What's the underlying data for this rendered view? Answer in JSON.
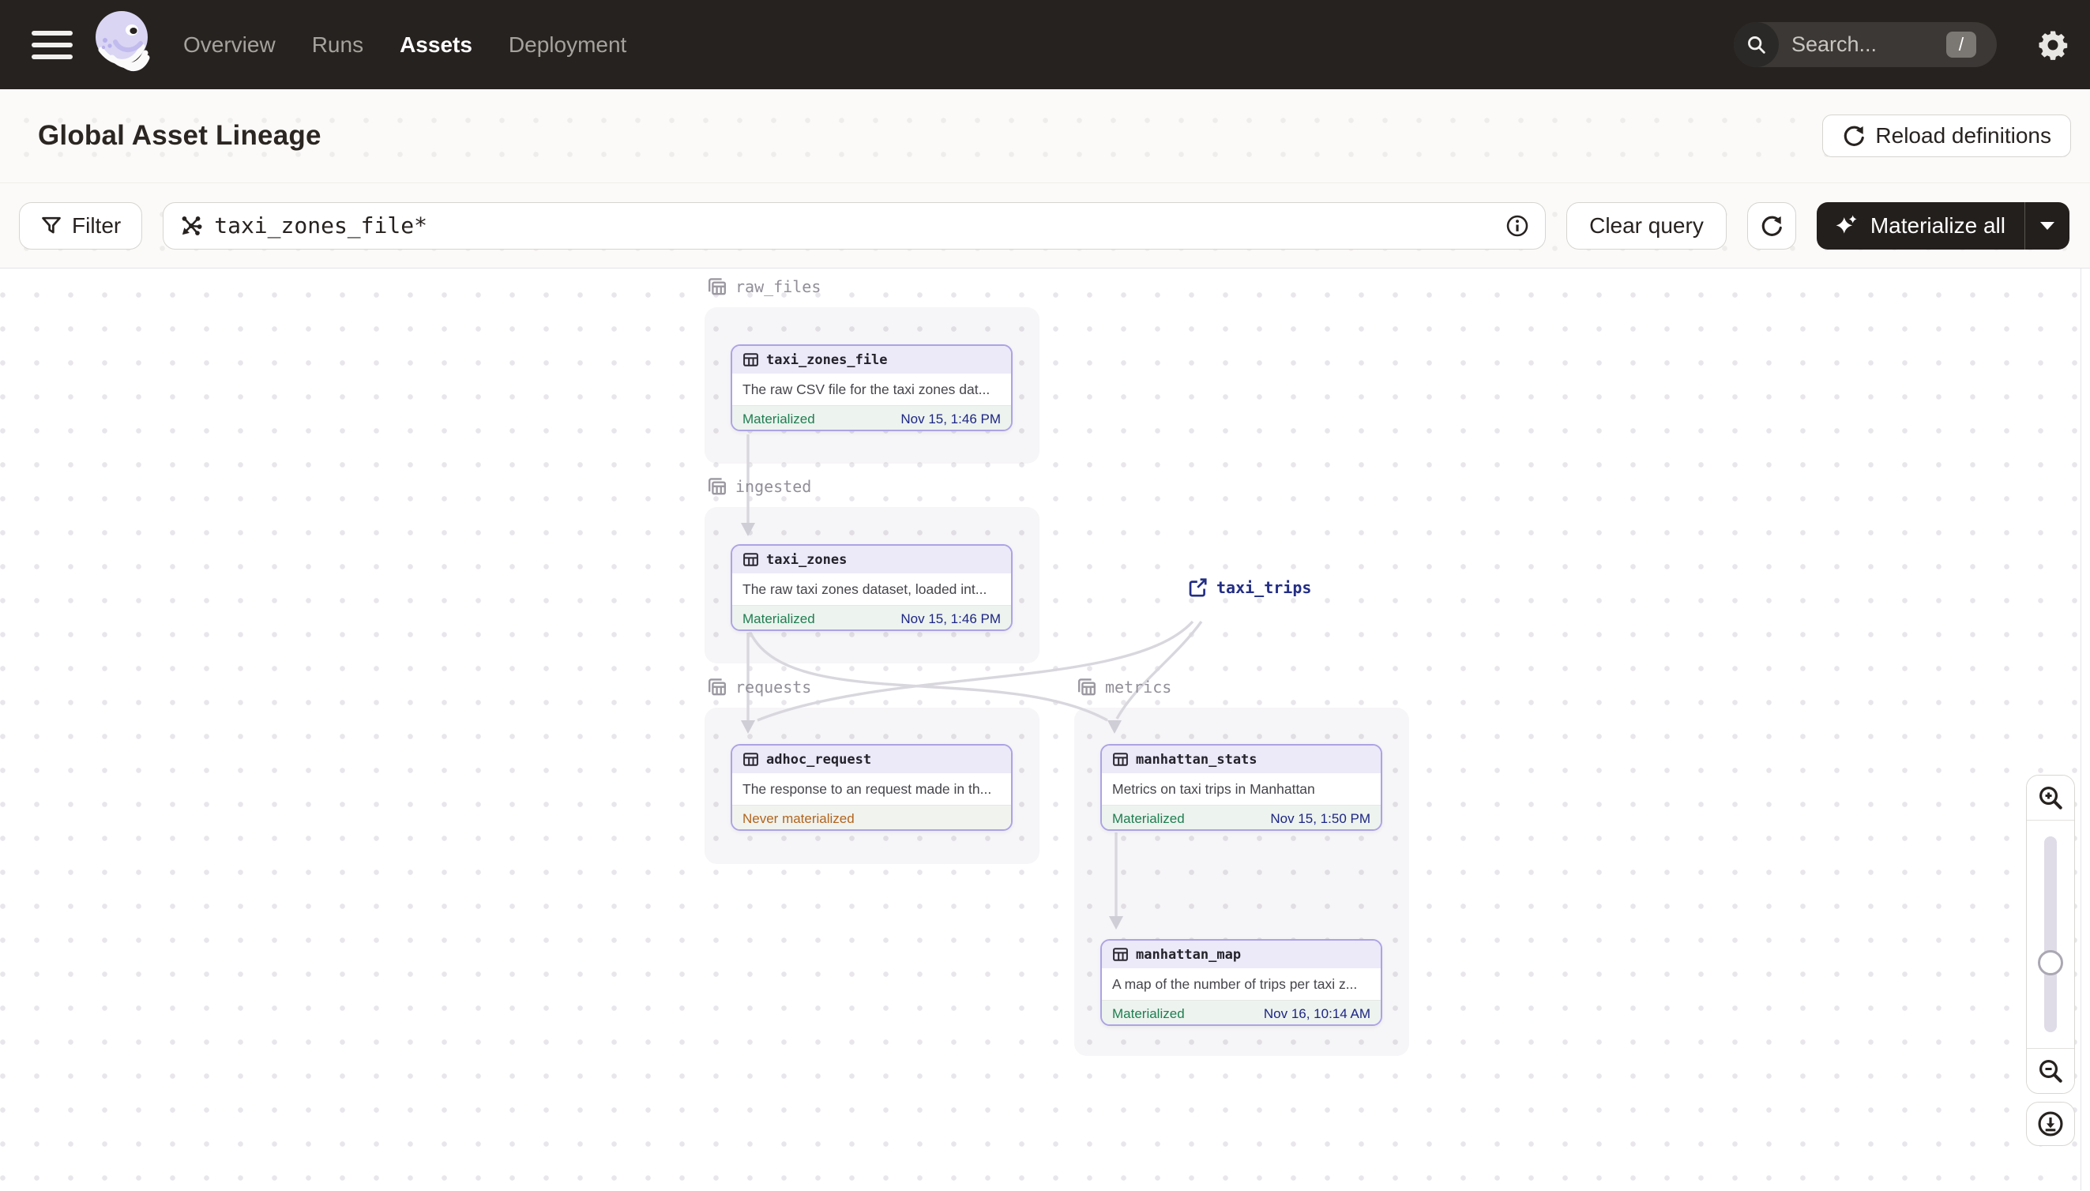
{
  "nav": {
    "items": [
      "Overview",
      "Runs",
      "Assets",
      "Deployment"
    ],
    "active_item": "Assets",
    "search_placeholder": "Search...",
    "search_shortcut": "/"
  },
  "header": {
    "title": "Global Asset Lineage",
    "reload_button": "Reload definitions"
  },
  "toolbar": {
    "filter_label": "Filter",
    "query_value": "taxi_zones_file*",
    "clear_query_label": "Clear query",
    "materialize_label": "Materialize all"
  },
  "graph": {
    "groups": [
      {
        "name": "raw_files"
      },
      {
        "name": "ingested"
      },
      {
        "name": "requests"
      },
      {
        "name": "metrics"
      }
    ],
    "nodes": [
      {
        "id": "taxi_zones_file",
        "group": "raw_files",
        "description": "The raw CSV file for the taxi zones dat...",
        "status": "Materialized",
        "timestamp": "Nov 15, 1:46 PM"
      },
      {
        "id": "taxi_zones",
        "group": "ingested",
        "description": "The raw taxi zones dataset, loaded int...",
        "status": "Materialized",
        "timestamp": "Nov 15, 1:46 PM"
      },
      {
        "id": "adhoc_request",
        "group": "requests",
        "description": "The response to an request made in th...",
        "status": "Never materialized",
        "timestamp": ""
      },
      {
        "id": "manhattan_stats",
        "group": "metrics",
        "description": "Metrics on taxi trips in Manhattan",
        "status": "Materialized",
        "timestamp": "Nov 15, 1:50 PM"
      },
      {
        "id": "manhattan_map",
        "group": "metrics",
        "description": "A map of the number of trips per taxi z...",
        "status": "Materialized",
        "timestamp": "Nov 16, 10:14 AM"
      }
    ],
    "external": [
      {
        "id": "taxi_trips"
      }
    ],
    "edges": [
      "taxi_zones_file->taxi_zones",
      "taxi_zones->adhoc_request",
      "taxi_zones->manhattan_stats",
      "taxi_trips->adhoc_request",
      "taxi_trips->manhattan_stats",
      "manhattan_stats->manhattan_map"
    ]
  },
  "icons": {
    "menu-icon": "hamburger",
    "dagster-logo": "octopus swirl",
    "search-icon": "magnifier",
    "settings-gear-icon": "gear",
    "reload-icon": "circular arrow",
    "filter-funnel-icon": "funnel",
    "graph-query-icon": "asterisk graph selector",
    "info-icon": "circled i",
    "refresh-icon": "circular arrow",
    "sparkle-icon": "two four-point stars",
    "caret-down-icon": "triangle",
    "table-icon": "data table grid",
    "group-tables-icon": "stacked tables",
    "external-link-icon": "box with arrow",
    "zoom-in-icon": "magnifier plus",
    "zoom-out-icon": "magnifier minus",
    "download-icon": "circled down arrow"
  },
  "colors": {
    "nav_bg": "#26221f",
    "accent_lavender": "#aca3e4",
    "node_header_bg": "#ece9f8",
    "materialized_green": "#1e7e51",
    "never_materialized_orange": "#b2641c",
    "timestamp_navy": "#1d2684",
    "edge_gray": "#d9d7de",
    "dark_button": "#231f1c"
  }
}
